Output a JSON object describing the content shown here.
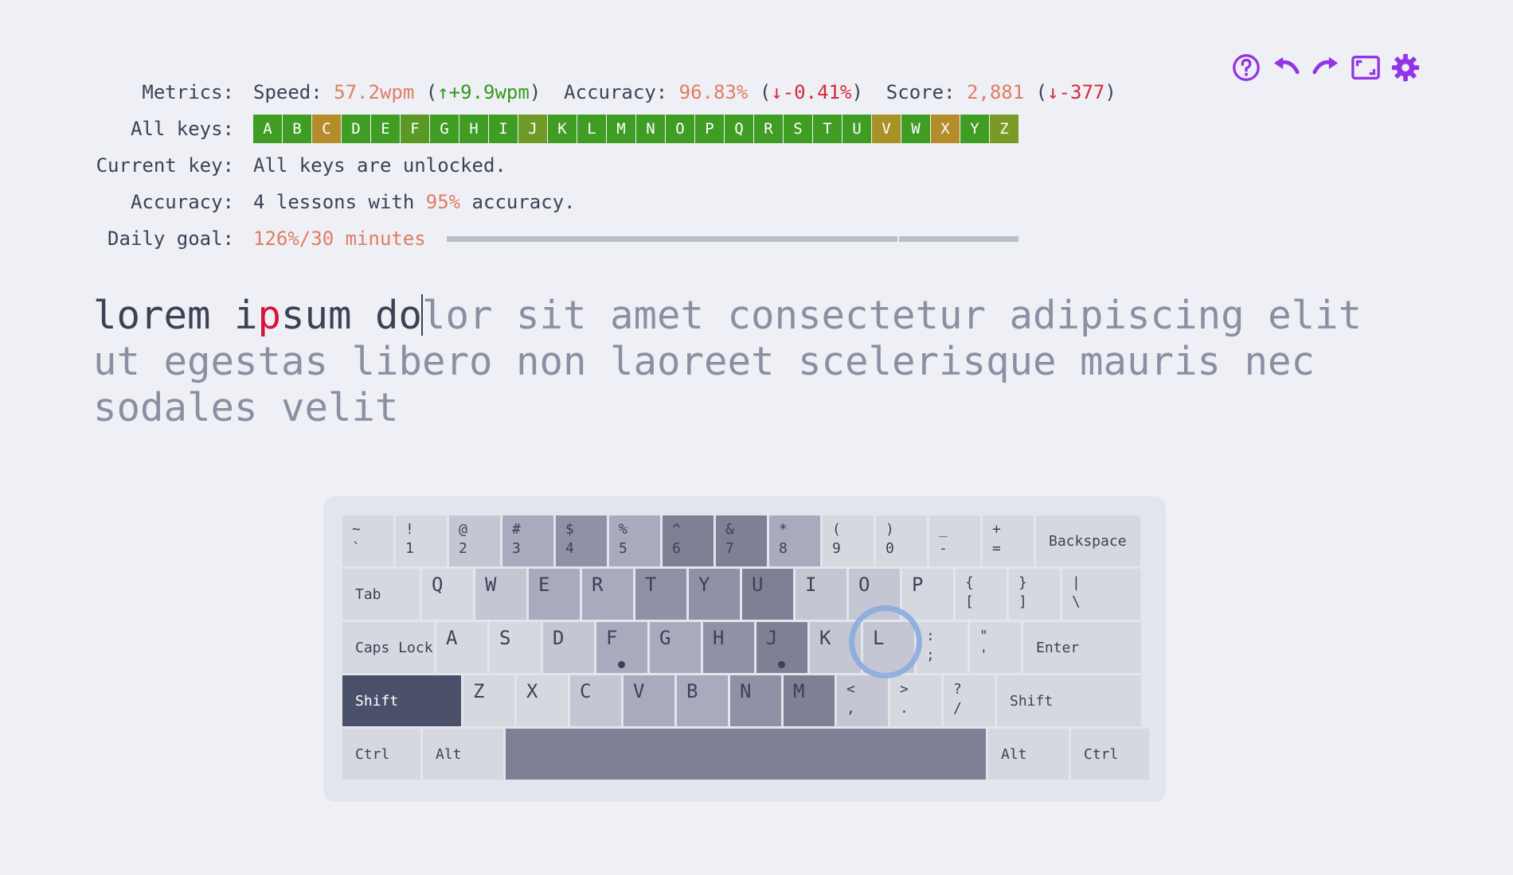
{
  "toolbar": {
    "icons": [
      "help-icon",
      "undo-icon",
      "redo-icon",
      "fullscreen-icon",
      "settings-icon"
    ],
    "accent": "#9334e6"
  },
  "metrics": {
    "label": "Metrics:",
    "speed_label": "Speed:",
    "speed_value": "57.2wpm",
    "speed_delta": "↑+9.9wpm",
    "accuracy_label": "Accuracy:",
    "accuracy_value": "96.83%",
    "accuracy_delta": "↓-0.41%",
    "score_label": "Score:",
    "score_value": "2,881",
    "score_delta": "↓-377"
  },
  "all_keys": {
    "label": "All keys:",
    "keys": [
      {
        "k": "A",
        "color": "#3f9d24"
      },
      {
        "k": "B",
        "color": "#3f9d24"
      },
      {
        "k": "C",
        "color": "#b48c2a"
      },
      {
        "k": "D",
        "color": "#3f9d24"
      },
      {
        "k": "E",
        "color": "#3f9d24"
      },
      {
        "k": "F",
        "color": "#5a9a24"
      },
      {
        "k": "G",
        "color": "#3f9d24"
      },
      {
        "k": "H",
        "color": "#3f9d24"
      },
      {
        "k": "I",
        "color": "#3f9d24"
      },
      {
        "k": "J",
        "color": "#6f9a26"
      },
      {
        "k": "K",
        "color": "#3f9d24"
      },
      {
        "k": "L",
        "color": "#3f9d24"
      },
      {
        "k": "M",
        "color": "#3f9d24"
      },
      {
        "k": "N",
        "color": "#3f9d24"
      },
      {
        "k": "O",
        "color": "#3f9d24"
      },
      {
        "k": "P",
        "color": "#3f9d24"
      },
      {
        "k": "Q",
        "color": "#3f9d24"
      },
      {
        "k": "R",
        "color": "#3f9d24"
      },
      {
        "k": "S",
        "color": "#3f9d24"
      },
      {
        "k": "T",
        "color": "#3f9d24"
      },
      {
        "k": "U",
        "color": "#3f9d24"
      },
      {
        "k": "V",
        "color": "#a89228"
      },
      {
        "k": "W",
        "color": "#3f9d24"
      },
      {
        "k": "X",
        "color": "#b48c2a"
      },
      {
        "k": "Y",
        "color": "#3f9d24"
      },
      {
        "k": "Z",
        "color": "#7a9a26"
      }
    ]
  },
  "current_key": {
    "label": "Current key:",
    "value": "All keys are unlocked."
  },
  "accuracy_goal": {
    "label": "Accuracy:",
    "pre": "4 lessons with ",
    "pct": "95%",
    "post": " accuracy."
  },
  "daily_goal": {
    "label": "Daily goal:",
    "value": "126%/30 minutes",
    "progress": 1.0
  },
  "lesson": {
    "typed_1": "lorem i",
    "miss": "p",
    "typed_2": "sum do",
    "rest": "lor sit amet consectetur adipiscing elit ut egestas libero non laoreet scelerisque mauris nec sodales velit"
  },
  "keyboard": {
    "rows": [
      [
        [
          "~",
          "`"
        ],
        [
          "!",
          "1"
        ],
        [
          "@",
          "2"
        ],
        [
          "#",
          "3"
        ],
        [
          "$",
          "4"
        ],
        [
          "%",
          "5"
        ],
        [
          "^",
          "6"
        ],
        [
          "&",
          "7"
        ],
        [
          "*",
          "8"
        ],
        [
          "(",
          "9"
        ],
        [
          ")",
          "0"
        ],
        [
          "_",
          "-"
        ],
        [
          "+",
          "="
        ],
        "Backspace"
      ],
      [
        "Tab",
        "Q",
        "W",
        "E",
        "R",
        "T",
        "Y",
        "U",
        "I",
        "O",
        "P",
        [
          "{",
          "["
        ],
        [
          "}",
          "]"
        ],
        [
          "|",
          "\\"
        ]
      ],
      [
        "Caps Lock",
        "A",
        "S",
        "D",
        "F",
        "G",
        "H",
        "J",
        "K",
        "L",
        [
          ":",
          ";"
        ],
        [
          "\"",
          "'"
        ],
        "Enter"
      ],
      [
        "Shift",
        "Z",
        "X",
        "C",
        "V",
        "B",
        "N",
        "M",
        [
          "<",
          ","
        ],
        [
          ">",
          "."
        ],
        [
          "?",
          "/"
        ],
        "Shift"
      ],
      [
        "Ctrl",
        "Alt",
        "",
        "Alt",
        "Ctrl"
      ]
    ]
  }
}
